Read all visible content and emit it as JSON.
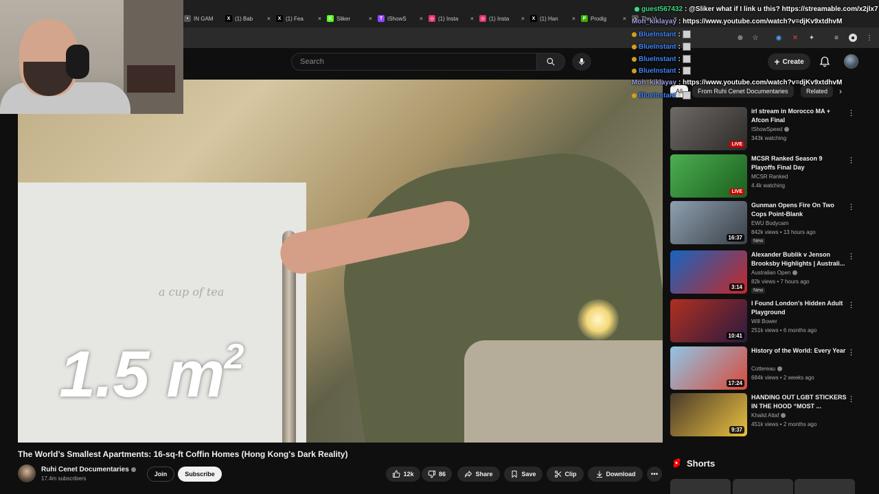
{
  "browser": {
    "tabs": [
      {
        "label": "IN GAM",
        "icon": "tab-icon",
        "color": "#555555"
      },
      {
        "label": "(1) Bab",
        "icon": "x-logo-icon",
        "color": "#000000"
      },
      {
        "label": "(1) Fea",
        "icon": "x-logo-icon",
        "color": "#000000"
      },
      {
        "label": "Sliker",
        "icon": "kick-logo-icon",
        "color": "#53fc18"
      },
      {
        "label": "IShowS",
        "icon": "twitch-logo-icon",
        "color": "#9146ff"
      },
      {
        "label": "(1) Insta",
        "icon": "instagram-logo-icon",
        "color": "#e1306c"
      },
      {
        "label": "(1) Insta",
        "icon": "instagram-logo-icon",
        "color": "#e1306c"
      },
      {
        "label": "(1) Han",
        "icon": "x-logo-icon",
        "color": "#000000"
      },
      {
        "label": "Prodig",
        "icon": "prodigy-logo-icon",
        "color": "#38b000"
      },
      {
        "label": "The V",
        "icon": "tab-icon",
        "color": "#555555"
      }
    ]
  },
  "header": {
    "search_placeholder": "Search",
    "create_label": "Create"
  },
  "video": {
    "overlay_text": "1.5 m",
    "overlay_sup": "2",
    "cup_text": "a cup of tea",
    "title": "The World’s Smallest Apartments: 16-sq-ft Coffin Homes (Hong Kong's Dark Reality)",
    "channel": "Ruhi Cenet Documentaries",
    "subscribers": "17.4m subscribers",
    "join_label": "Join",
    "subscribe_label": "Subscribe",
    "likes": "12k",
    "dislikes": "86",
    "share_label": "Share",
    "save_label": "Save",
    "clip_label": "Clip",
    "download_label": "Download"
  },
  "chips": [
    "All",
    "From Ruhi Cenet Documentaries",
    "Related"
  ],
  "recommendations": [
    {
      "title": "irl stream in Morocco MA + Afcon Final",
      "channel": "IShowSpeed",
      "verified": true,
      "stats": "343k watching",
      "live": true,
      "badge_text": "LIVE",
      "duration": "",
      "is_new": false,
      "colors": [
        "#6e6a66",
        "#2d2b29"
      ]
    },
    {
      "title": "MCSR Ranked Season 9 Playoffs Final Day",
      "channel": "MCSR Ranked",
      "verified": false,
      "stats": "4.4k watching",
      "live": true,
      "badge_text": "LIVE",
      "duration": "",
      "is_new": false,
      "colors": [
        "#4caf50",
        "#1b5e20"
      ]
    },
    {
      "title": "Gunman Opens Fire On Two Cops Point-Blank",
      "channel": "EWU Bodycam",
      "verified": false,
      "stats": "842k views • 13 hours ago",
      "live": false,
      "badge_text": "",
      "duration": "16:37",
      "is_new": true,
      "colors": [
        "#8ea0b0",
        "#3a4048"
      ]
    },
    {
      "title": "Alexander Bublik v Jenson Brooksby Highlights | Australi...",
      "channel": "Australian Open",
      "verified": true,
      "stats": "82k views • 7 hours ago",
      "live": false,
      "badge_text": "",
      "duration": "3:14",
      "is_new": true,
      "colors": [
        "#1565c0",
        "#c62828"
      ]
    },
    {
      "title": "I Found London's Hidden Adult Playground",
      "channel": "Will Bower",
      "verified": false,
      "stats": "251k views • 6 months ago",
      "live": false,
      "badge_text": "",
      "duration": "10:41",
      "is_new": false,
      "colors": [
        "#b03020",
        "#2a1a40"
      ]
    },
    {
      "title": "History of the World: Every Year",
      "channel": "Cottereau",
      "verified": true,
      "stats": "684k views • 2 weeks ago",
      "live": false,
      "badge_text": "",
      "duration": "17:24",
      "is_new": false,
      "colors": [
        "#8ec6e6",
        "#d84a3a"
      ]
    },
    {
      "title": "HANDING OUT LGBT STICKERS IN THE HOOD “MOST ...",
      "channel": "Khalid Attaf",
      "verified": true,
      "stats": "451k views • 2 months ago",
      "live": false,
      "badge_text": "",
      "duration": "9:37",
      "is_new": false,
      "colors": [
        "#4a3a2a",
        "#e8c040"
      ]
    }
  ],
  "new_badge": "New",
  "shorts_label": "Shorts",
  "chat": [
    {
      "user": "guest567432",
      "color": "#3ddc84",
      "message": ": @Sliker what if I link u this? https://streamable.com/x2jlx7",
      "emote": false
    },
    {
      "user": "Moh_kiklayay",
      "color": "#9e9ee0",
      "message": ": https://www.youtube.com/watch?v=djKv9xtdhvM",
      "emote": false
    },
    {
      "user": "BlueInstant",
      "color": "#3b82f6",
      "message": " : ",
      "emote": true
    },
    {
      "user": "BlueInstant",
      "color": "#3b82f6",
      "message": " : ",
      "emote": true
    },
    {
      "user": "BlueInstant",
      "color": "#3b82f6",
      "message": " : ",
      "emote": true
    },
    {
      "user": "BlueInstant",
      "color": "#3b82f6",
      "message": " : ",
      "emote": true
    },
    {
      "user": "Moh_kiklayay",
      "color": "#9e9ee0",
      "message": ": https://www.youtube.com/watch?v=djKv9xtdhvM",
      "emote": false
    },
    {
      "user": "BlueInstant",
      "color": "#3b82f6",
      "message": " : ",
      "emote": true
    }
  ]
}
